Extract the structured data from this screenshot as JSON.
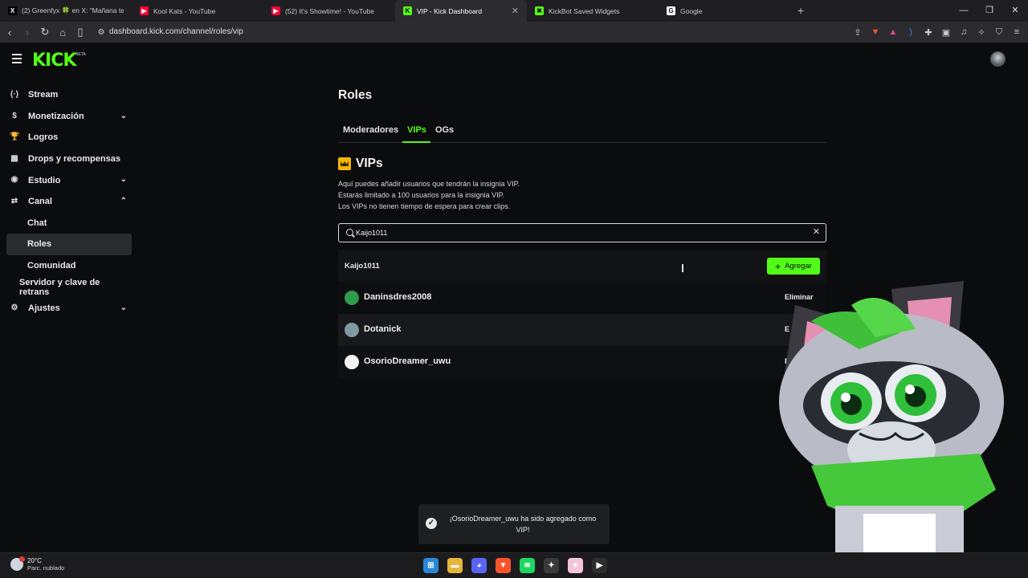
{
  "browser": {
    "tabs": [
      {
        "title": "(2) Greenfyx 🍀 en X: \"Mañana teng",
        "favicon": "x-logo-icon",
        "color": "#000000",
        "glyph": "X"
      },
      {
        "title": "Kool Kats - YouTube",
        "favicon": "youtube-icon",
        "color": "#ff0033",
        "glyph": "▶"
      },
      {
        "title": "(52) It's Showtime! - YouTube",
        "favicon": "youtube-icon",
        "color": "#ff0033",
        "glyph": "▶"
      },
      {
        "title": "VIP - Kick Dashboard",
        "favicon": "kick-icon",
        "color": "#53fc18",
        "glyph": "K"
      },
      {
        "title": "KickBot Saved Widgets",
        "favicon": "kickbot-icon",
        "color": "#53fc18",
        "glyph": "✖"
      },
      {
        "title": "Google",
        "favicon": "google-icon",
        "color": "#ffffff",
        "glyph": "G"
      }
    ],
    "active_tab": 3,
    "url": "dashboard.kick.com/channel/roles/vip"
  },
  "brand": {
    "logo": "KICK",
    "beta": "BETA",
    "accent": "#53fc18"
  },
  "sidebar": {
    "items": [
      {
        "label": "Stream",
        "icon": "broadcast-icon",
        "glyph": "(·)",
        "chevron": ""
      },
      {
        "label": "Monetización",
        "icon": "dollar-icon",
        "glyph": "$",
        "chevron": "down"
      },
      {
        "label": "Logros",
        "icon": "trophy-icon",
        "glyph": "🏆",
        "chevron": ""
      },
      {
        "label": "Drops y recompensas",
        "icon": "gift-icon",
        "glyph": "▦",
        "chevron": ""
      },
      {
        "label": "Estudio",
        "icon": "studio-icon",
        "glyph": "◉",
        "chevron": "down"
      },
      {
        "label": "Canal",
        "icon": "channel-icon",
        "glyph": "⇄",
        "chevron": "up"
      }
    ],
    "subitems": [
      {
        "label": "Chat"
      },
      {
        "label": "Roles"
      },
      {
        "label": "Comunidad"
      }
    ],
    "extra": {
      "label": "Servidor y clave de retrans"
    },
    "settings": {
      "label": "Ajustes",
      "icon": "gear-icon",
      "glyph": "⚙",
      "chevron": "down"
    }
  },
  "main": {
    "title": "Roles",
    "tabs": [
      "Moderadores",
      "VIPs",
      "OGs"
    ],
    "active_tab": 1,
    "section_title": "VIPs",
    "description": [
      "Aquí puedes añadir usuarios que tendrán la insignia VIP.",
      "Estarás limitado a 100 usuarios para la insignia VIP.",
      "Los VIPs no tienen tiempo de espera para crear clips."
    ],
    "search": {
      "value": "Kaijo1011",
      "placeholder": ""
    },
    "result": {
      "name": "Kaijo1011",
      "add_label": "Agregar"
    },
    "vips": [
      {
        "name": "Daninsdres2008",
        "action": "Eliminar",
        "avatar_color": "#2e9c4a"
      },
      {
        "name": "Dotanick",
        "action": "E",
        "avatar_color": "#7f9aa0"
      },
      {
        "name": "OsorioDreamer_uwu",
        "action": "E",
        "avatar_color": "#f2f2f2"
      }
    ]
  },
  "toast": {
    "message": "¡OsorioDreamer_uwu ha sido agregado como VIP!"
  },
  "taskbar": {
    "weather_temp": "20°C",
    "weather_desc": "Parc. nublado",
    "apps": [
      {
        "name": "windows-start-icon",
        "color": "#2b88d8",
        "glyph": "⊞"
      },
      {
        "name": "file-explorer-icon",
        "color": "#e7b53c",
        "glyph": "▬"
      },
      {
        "name": "discord-icon",
        "color": "#5865f2",
        "glyph": "◕"
      },
      {
        "name": "brave-icon",
        "color": "#fb542b",
        "glyph": "▼"
      },
      {
        "name": "spotify-icon",
        "color": "#1ed760",
        "glyph": "≋"
      },
      {
        "name": "app-icon",
        "color": "#3a3a3a",
        "glyph": "✦"
      },
      {
        "name": "app2-icon",
        "color": "#f4c6d6",
        "glyph": "♥"
      },
      {
        "name": "player-icon",
        "color": "#2d2d2d",
        "glyph": "▶"
      }
    ]
  }
}
